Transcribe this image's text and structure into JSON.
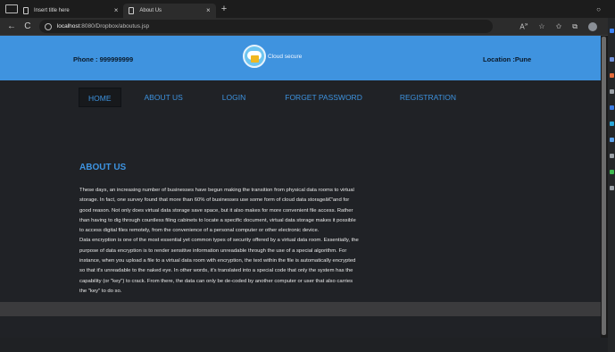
{
  "browser": {
    "tabs": [
      {
        "title": "Insert title here",
        "close": "×"
      },
      {
        "title": "About Us",
        "close": "×"
      }
    ],
    "new_tab": "+",
    "window_control": "○",
    "url_host": "localhost",
    "url_path": ":8080/Dropbox/aboutus.jsp",
    "nav": {
      "back": "←",
      "refresh": "C"
    }
  },
  "header": {
    "phone": "Phone : 999999999",
    "brand": "Cloud secure",
    "location": "Location :Pune"
  },
  "menu": {
    "home": "HOME",
    "about": "ABOUT US",
    "login": "LOGIN",
    "forget": "FORGET PASSWORD",
    "registration": "REGISTRATION"
  },
  "about": {
    "title": "ABOUT US",
    "lines": [
      "These days, an increasing number of businesses have begun making the transition from physical data rooms to virtual",
      "storage. In fact, one survey found that more than 60% of businesses use some form of cloud data storageâ€”and for",
      "good reason. Not only does virtual data storage save space, but it also makes for more convenient file access. Rather",
      "than having to dig through countless filing cabinets to locate a specific document, virtual data storage makes it possible",
      "to access digital files remotely, from the convenience of a personal computer or other electronic device.",
      "Data encryption is one of the most essential yet common types of security offered by a virtual data room. Essentially, the",
      "purpose of data encryption is to render sensitive information unreadable through the use of a special algorithm. For",
      "instance, when you upload a file to a virtual data room with encryption, the text within the file is automatically encrypted",
      "so that it's unreadable to the naked eye. In other words, it's translated into a special code that only the system has the",
      "capability (or \"key\") to crack. From there, the data can only be de-coded by another computer or user that also carries",
      "the \"key\" to do so."
    ]
  },
  "colors": {
    "header_blue": "#3f93df",
    "menu_blue": "#3d93e0",
    "page_bg": "#202226"
  }
}
